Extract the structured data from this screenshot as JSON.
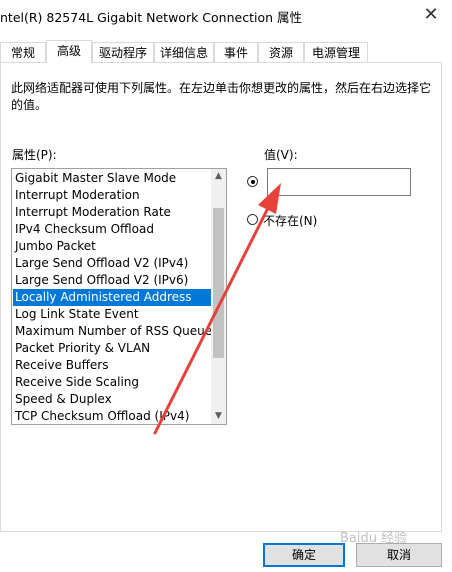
{
  "window": {
    "title": "ntel(R) 82574L Gigabit Network Connection 属性",
    "close_glyph": "✕"
  },
  "tabs": [
    {
      "label": "常规"
    },
    {
      "label": "高级",
      "active": true
    },
    {
      "label": "驱动程序"
    },
    {
      "label": "详细信息"
    },
    {
      "label": "事件"
    },
    {
      "label": "资源"
    },
    {
      "label": "电源管理"
    }
  ],
  "description": "此网络适配器可使用下列属性。在左边单击你想更改的属性，然后在右边选择它的值。",
  "properties": {
    "label": "属性(P):",
    "items": [
      "Gigabit Master Slave Mode",
      "Interrupt Moderation",
      "Interrupt Moderation Rate",
      "IPv4 Checksum Offload",
      "Jumbo Packet",
      "Large Send Offload V2 (IPv4)",
      "Large Send Offload V2 (IPv6)",
      "Locally Administered Address",
      "Log Link State Event",
      "Maximum Number of RSS Queues",
      "Packet Priority & VLAN",
      "Receive Buffers",
      "Receive Side Scaling",
      "Speed & Duplex",
      "TCP Checksum Offload (IPv4)"
    ],
    "selected_index": 7,
    "scroll_up_glyph": "▲",
    "scroll_down_glyph": "▼"
  },
  "value": {
    "label": "值(V):",
    "input_value": "",
    "absent_label": "不存在(N)",
    "value_radio_selected": true,
    "absent_radio_selected": false
  },
  "buttons": {
    "ok": "确定",
    "cancel": "取消"
  },
  "annotation": {
    "color": "#e8403a"
  },
  "watermark": {
    "text": "Baidu 经验"
  }
}
